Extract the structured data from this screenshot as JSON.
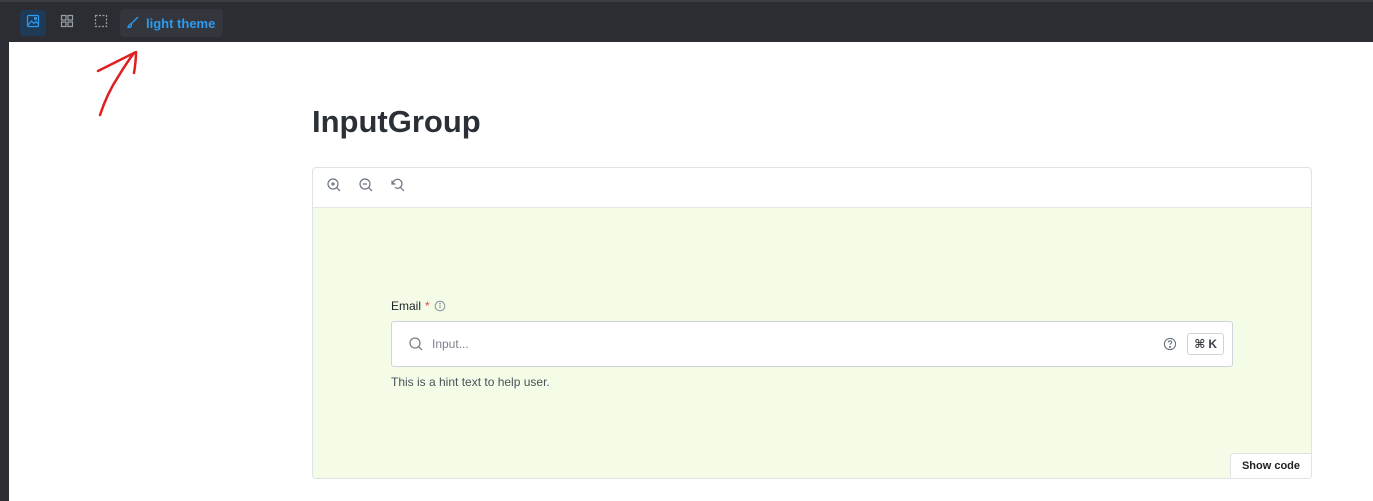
{
  "toolbar": {
    "buttons": [
      {
        "name": "image-icon",
        "active": true
      },
      {
        "name": "grid-icon",
        "active": false
      },
      {
        "name": "outline-icon",
        "active": false
      }
    ],
    "theme_label": "light theme"
  },
  "page": {
    "title": "InputGroup"
  },
  "story": {
    "zoom_buttons": [
      "zoom-in-icon",
      "zoom-out-icon",
      "zoom-reset-icon"
    ],
    "field": {
      "label": "Email",
      "required_mark": "*",
      "placeholder": "Input...",
      "shortcut_symbol": "⌘",
      "shortcut_key": "K",
      "hint": "This is a hint text to help user."
    },
    "show_code_label": "Show code"
  },
  "colors": {
    "toolbar_bg": "#2b2d33",
    "accent": "#2c9bf0",
    "preview_bg": "#f4fce8",
    "annotation": "#e02020"
  }
}
